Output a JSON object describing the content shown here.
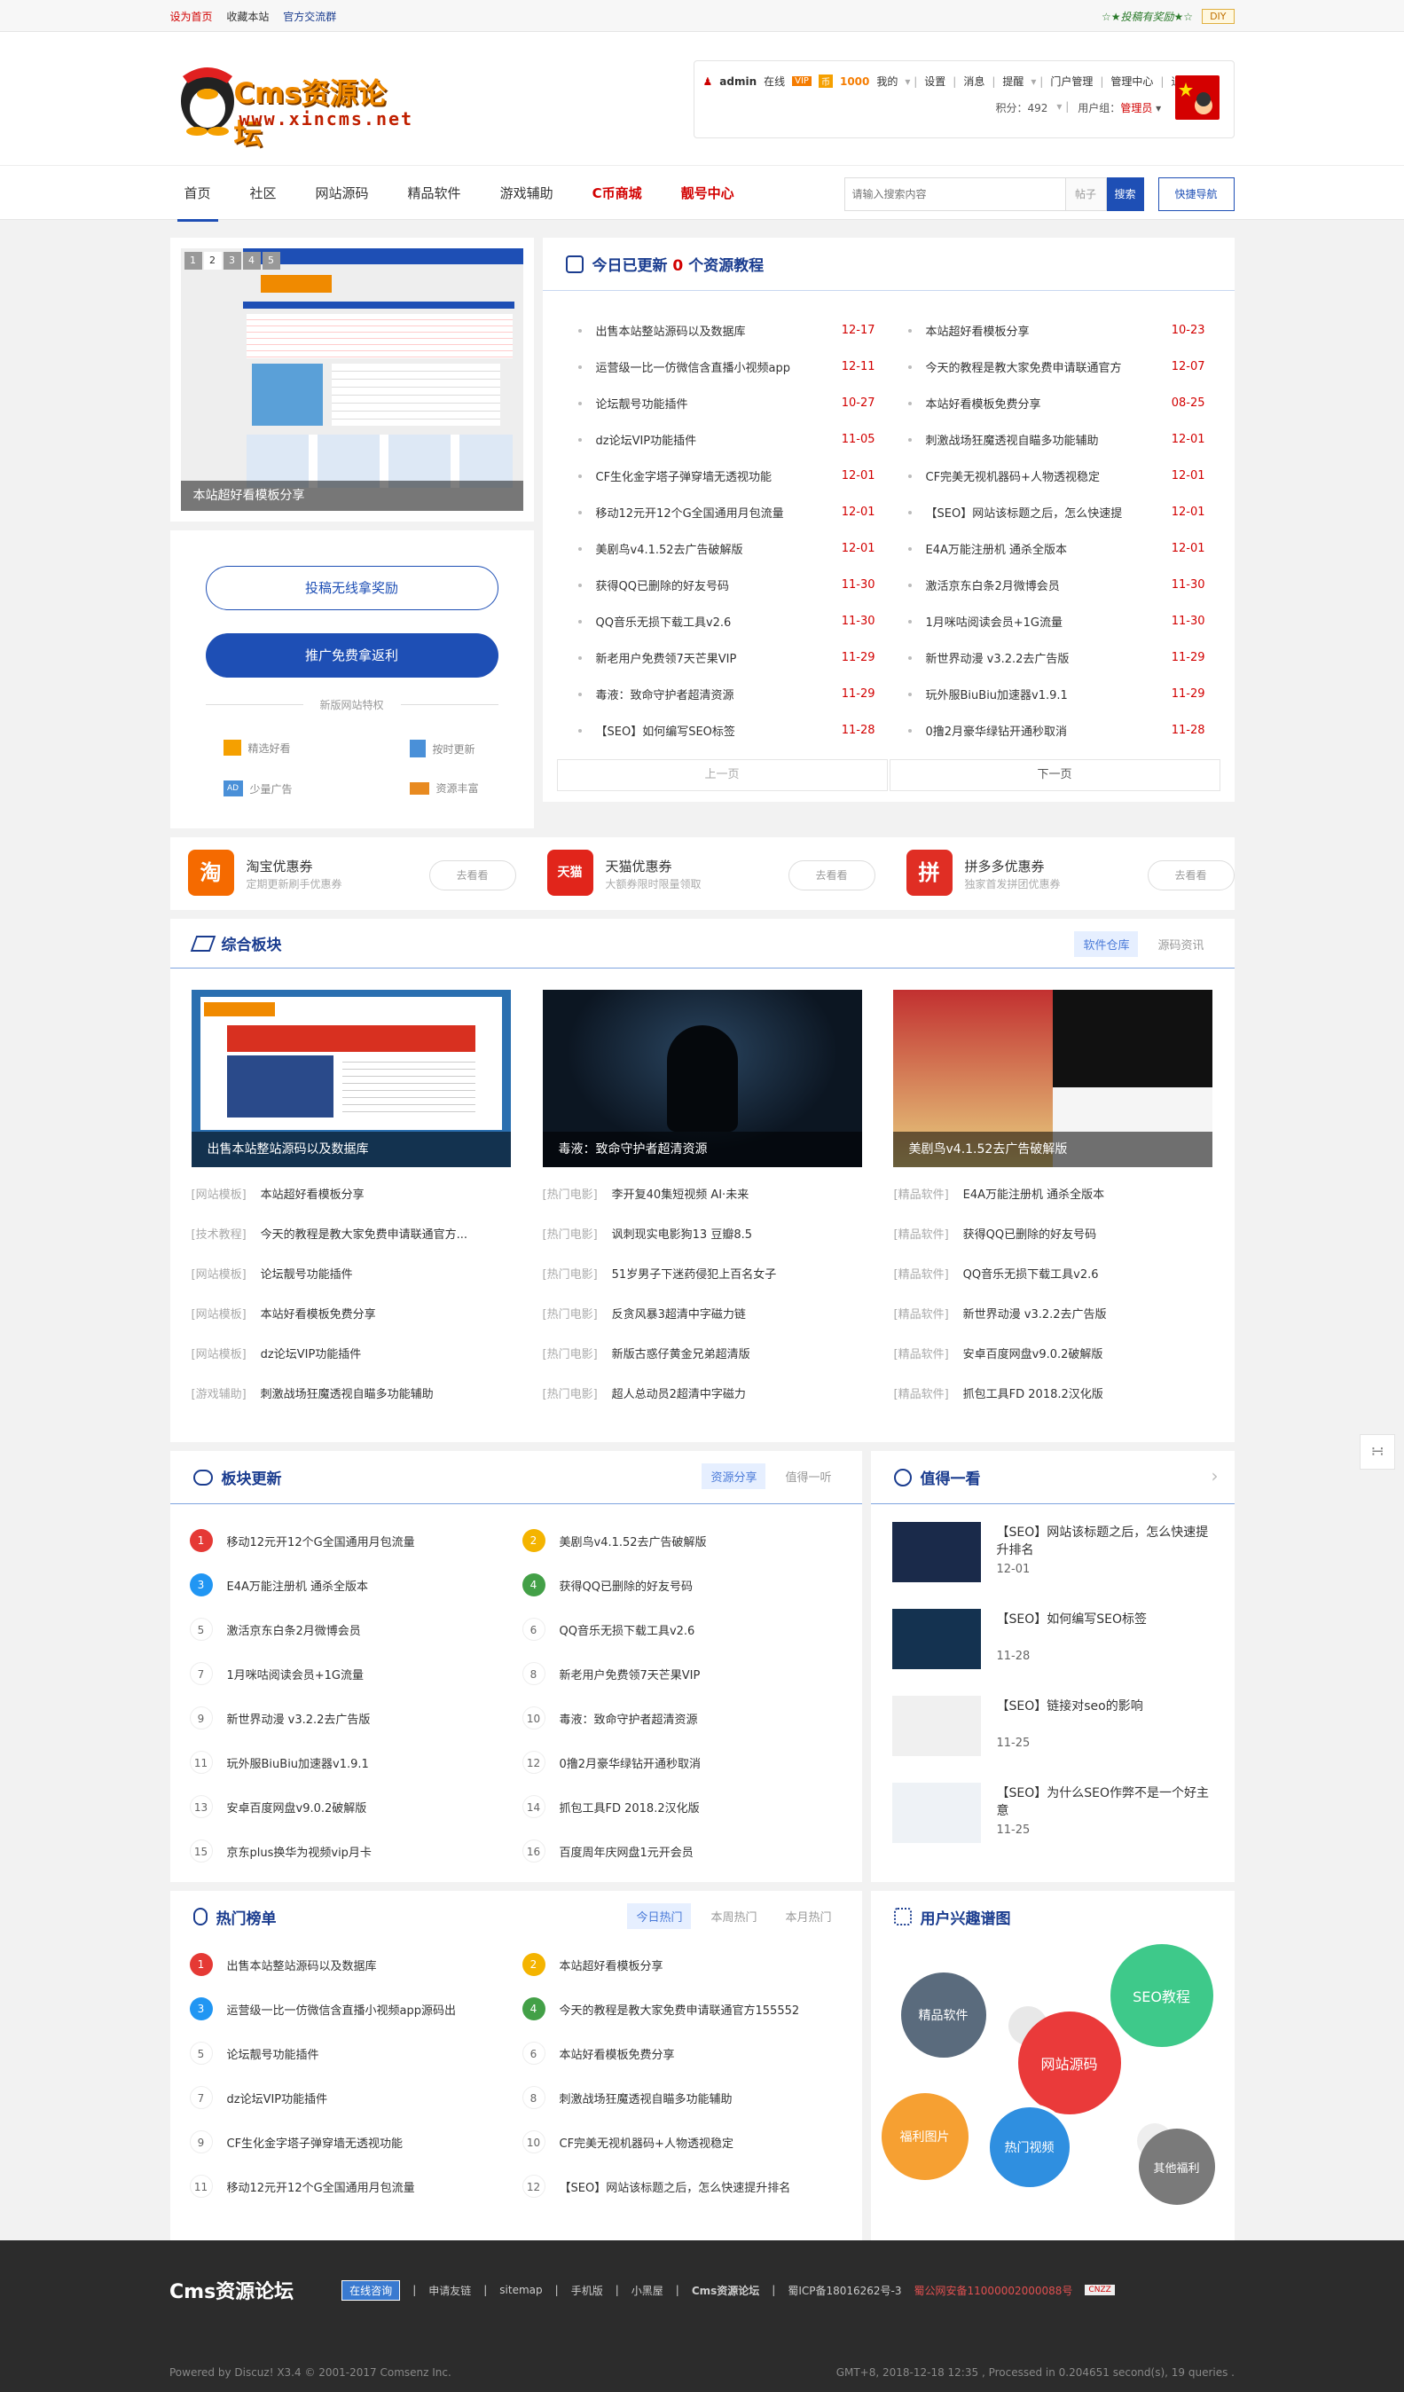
{
  "topbar": {
    "set_home": "设为首页",
    "bookmark": "收藏本站",
    "group": "官方交流群",
    "promo": "☆★投稿有奖励★☆",
    "diy": "DIY"
  },
  "header": {
    "logo_text": "Cms资源论坛",
    "logo_url": "www.xincms.net",
    "user": {
      "name": "admin",
      "status": "在线",
      "credit": "1000",
      "links": [
        "我的",
        "设置",
        "消息",
        "提醒",
        "门户管理",
        "管理中心",
        "退出"
      ],
      "points_label": "积分：492",
      "group_label": "用户组：",
      "group_value": "管理员"
    }
  },
  "nav": {
    "items": [
      {
        "label": "首页"
      },
      {
        "label": "社区"
      },
      {
        "label": "网站源码"
      },
      {
        "label": "精品软件"
      },
      {
        "label": "游戏辅助"
      },
      {
        "label": "C币商城"
      },
      {
        "label": "靓号中心"
      }
    ],
    "search_placeholder": "请输入搜索内容",
    "search_cat": "帖子",
    "search_btn": "搜索",
    "quick_nav": "快捷导航"
  },
  "slider": {
    "pages": [
      "1",
      "2",
      "3",
      "4",
      "5"
    ],
    "caption": "本站超好看模板分享"
  },
  "side": {
    "btn1": "投稿无线拿奖励",
    "btn2": "推广免费拿返利",
    "divider": "新版网站特权",
    "features": [
      "精选好看",
      "按时更新",
      "少量广告",
      "资源丰富"
    ]
  },
  "today": {
    "title_pre": "今日已更新",
    "count": "0",
    "title_post": "个资源教程",
    "left": [
      {
        "t": "出售本站整站源码以及数据库",
        "d": "12-17"
      },
      {
        "t": "运营级一比一仿微信含直播小视频app",
        "d": "12-11"
      },
      {
        "t": "论坛靓号功能插件",
        "d": "10-27"
      },
      {
        "t": "dz论坛VIP功能插件",
        "d": "11-05"
      },
      {
        "t": "CF生化金字塔子弹穿墙无透视功能",
        "d": "12-01"
      },
      {
        "t": "移动12元开12个G全国通用月包流量",
        "d": "12-01"
      },
      {
        "t": "美剧鸟v4.1.52去广告破解版",
        "d": "12-01"
      },
      {
        "t": "获得QQ已删除的好友号码",
        "d": "11-30"
      },
      {
        "t": "QQ音乐无损下载工具v2.6",
        "d": "11-30"
      },
      {
        "t": "新老用户免费领7天芒果VIP",
        "d": "11-29"
      },
      {
        "t": "毒液：致命守护者超清资源",
        "d": "11-29"
      },
      {
        "t": "【SEO】如何编写SEO标签",
        "d": "11-28"
      }
    ],
    "right": [
      {
        "t": "本站超好看模板分享",
        "d": "10-23"
      },
      {
        "t": "今天的教程是教大家免费申请联通官方",
        "d": "12-07"
      },
      {
        "t": "本站好看模板免费分享",
        "d": "08-25"
      },
      {
        "t": "刺激战场狂魔透视自瞄多功能辅助",
        "d": "12-01"
      },
      {
        "t": "CF完美无视机器码+人物透视稳定",
        "d": "12-01"
      },
      {
        "t": "【SEO】网站该标题之后，怎么快速提",
        "d": "12-01"
      },
      {
        "t": "E4A万能注册机 通杀全版本",
        "d": "12-01"
      },
      {
        "t": "激活京东白条2月微博会员",
        "d": "11-30"
      },
      {
        "t": "1月咪咕阅读会员+1G流量",
        "d": "11-30"
      },
      {
        "t": "新世界动漫 v3.2.2去广告版",
        "d": "11-29"
      },
      {
        "t": "玩外服BiuBiu加速器v1.9.1",
        "d": "11-29"
      },
      {
        "t": "0撸2月豪华绿钻开通秒取消",
        "d": "11-28"
      }
    ],
    "prev": "上一页",
    "next": "下一页"
  },
  "coupons": [
    {
      "icon": "淘",
      "name": "淘宝优惠券",
      "sub": "定期更新刷手优惠券",
      "btn": "去看看",
      "color": "#f56a00"
    },
    {
      "icon": "天猫",
      "name": "天猫优惠券",
      "sub": "大额券限时限量领取",
      "btn": "去看看",
      "color": "#e1251b"
    },
    {
      "icon": "拼",
      "name": "拼多多优惠券",
      "sub": "独家首发拼团优惠券",
      "btn": "去看看",
      "color": "#e02e24"
    }
  ],
  "zonghe": {
    "title": "综合板块",
    "tabs": [
      "软件仓库",
      "源码资讯"
    ],
    "thumbs": [
      {
        "cap": "出售本站整站源码以及数据库"
      },
      {
        "cap": "毒液：致命守护者超清资源"
      },
      {
        "cap": "美剧鸟v4.1.52去广告破解版"
      }
    ],
    "cols": [
      [
        {
          "c": "[网站模板]",
          "t": "本站超好看模板分享"
        },
        {
          "c": "[技术教程]",
          "t": "今天的教程是教大家免费申请联通官方..."
        },
        {
          "c": "[网站模板]",
          "t": "论坛靓号功能插件"
        },
        {
          "c": "[网站模板]",
          "t": "本站好看模板免费分享"
        },
        {
          "c": "[网站模板]",
          "t": "dz论坛VIP功能插件"
        },
        {
          "c": "[游戏辅助]",
          "t": "刺激战场狂魔透视自瞄多功能辅助"
        }
      ],
      [
        {
          "c": "[热门电影]",
          "t": "李开复40集短视频 AI·未来"
        },
        {
          "c": "[热门电影]",
          "t": "讽刺现实电影狗13 豆瓣8.5"
        },
        {
          "c": "[热门电影]",
          "t": "51岁男子下迷药侵犯上百名女子"
        },
        {
          "c": "[热门电影]",
          "t": "反贪风暴3超清中字磁力链"
        },
        {
          "c": "[热门电影]",
          "t": "新版古惑仔黄金兄弟超清版"
        },
        {
          "c": "[热门电影]",
          "t": "超人总动员2超清中字磁力"
        }
      ],
      [
        {
          "c": "[精品软件]",
          "t": "E4A万能注册机 通杀全版本"
        },
        {
          "c": "[精品软件]",
          "t": "获得QQ已删除的好友号码"
        },
        {
          "c": "[精品软件]",
          "t": "QQ音乐无损下载工具v2.6"
        },
        {
          "c": "[精品软件]",
          "t": "新世界动漫 v3.2.2去广告版"
        },
        {
          "c": "[精品软件]",
          "t": "安卓百度网盘v9.0.2破解版"
        },
        {
          "c": "[精品软件]",
          "t": "抓包工具FD 2018.2汉化版"
        }
      ]
    ]
  },
  "bankuai": {
    "title": "板块更新",
    "tabs": [
      "资源分享",
      "值得一听"
    ],
    "items": [
      "移动12元开12个G全国通用月包流量",
      "美剧鸟v4.1.52去广告破解版",
      "E4A万能注册机 通杀全版本",
      "获得QQ已删除的好友号码",
      "激活京东白条2月微博会员",
      "QQ音乐无损下载工具v2.6",
      "1月咪咕阅读会员+1G流量",
      "新老用户免费领7天芒果VIP",
      "新世界动漫 v3.2.2去广告版",
      "毒液：致命守护者超清资源",
      "玩外服BiuBiu加速器v1.9.1",
      "0撸2月豪华绿钻开通秒取消",
      "安卓百度网盘v9.0.2破解版",
      "抓包工具FD 2018.2汉化版",
      "京东plus换华为视频vip月卡",
      "百度周年庆网盘1元开会员"
    ]
  },
  "zhide": {
    "title": "值得一看",
    "items": [
      {
        "t": "【SEO】网站该标题之后，怎么快速提升排名",
        "d": "12-01"
      },
      {
        "t": "【SEO】如何编写SEO标签",
        "d": "11-28"
      },
      {
        "t": "【SEO】链接对seo的影响",
        "d": "11-25"
      },
      {
        "t": "【SEO】为什么SEO作弊不是一个好主意",
        "d": "11-25"
      }
    ]
  },
  "hot": {
    "title": "热门榜单",
    "tabs": [
      "今日热门",
      "本周热门",
      "本月热门"
    ],
    "items": [
      "出售本站整站源码以及数据库",
      "本站超好看模板分享",
      "运营级一比一仿微信含直播小视频app源码出",
      "今天的教程是教大家免费申请联通官方155552",
      "论坛靓号功能插件",
      "本站好看模板免费分享",
      "dz论坛VIP功能插件",
      "刺激战场狂魔透视自瞄多功能辅助",
      "CF生化金字塔子弹穿墙无透视功能",
      "CF完美无视机器码+人物透视稳定",
      "移动12元开12个G全国通用月包流量",
      "【SEO】网站该标题之后，怎么快速提升排名"
    ]
  },
  "interest": {
    "title": "用户兴趣谱图",
    "bubbles": [
      {
        "label": "精品软件",
        "color": "#5a6b7d"
      },
      {
        "label": "SEO教程",
        "color": "#3ec98a"
      },
      {
        "label": "网站源码",
        "color": "#ea3a3a"
      },
      {
        "label": "福利图片",
        "color": "#f6a032"
      },
      {
        "label": "热门视频",
        "color": "#2f8fe0"
      },
      {
        "label": "其他福利",
        "color": "#7a7a7a"
      }
    ]
  },
  "footer": {
    "logo": "Cms资源论坛",
    "consult": "在线咨询",
    "links": [
      "申请友链",
      "sitemap",
      "手机版",
      "小黑屋",
      "Cms资源论坛",
      "蜀ICP备18016262号-3"
    ],
    "beian": "蜀公网安备11000002000088号",
    "powered": "Powered by Discuz! X3.4 © 2001-2017 Comsenz Inc.",
    "info": "GMT+8, 2018-12-18 12:35 , Processed in 0.204651 second(s), 19 queries ."
  }
}
